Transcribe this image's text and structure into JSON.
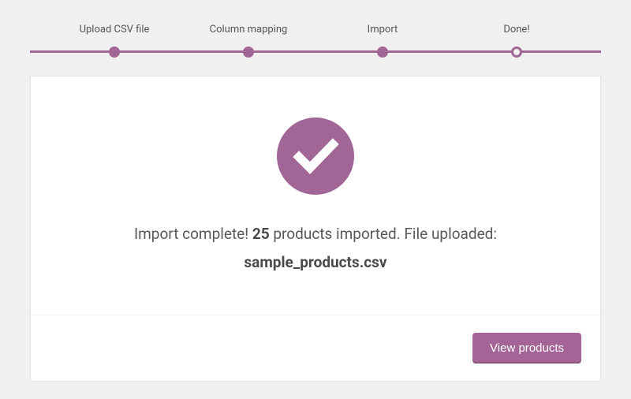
{
  "colors": {
    "accent": "#a16696",
    "button": "#a46497"
  },
  "stepper": {
    "steps": [
      {
        "label": "Upload CSV file",
        "state": "done"
      },
      {
        "label": "Column mapping",
        "state": "done"
      },
      {
        "label": "Import",
        "state": "done"
      },
      {
        "label": "Done!",
        "state": "current"
      }
    ]
  },
  "result": {
    "message_prefix": "Import complete! ",
    "count": "25",
    "message_mid": " products imported. File uploaded:",
    "filename": "sample_products.csv"
  },
  "actions": {
    "view_products_label": "View products"
  }
}
